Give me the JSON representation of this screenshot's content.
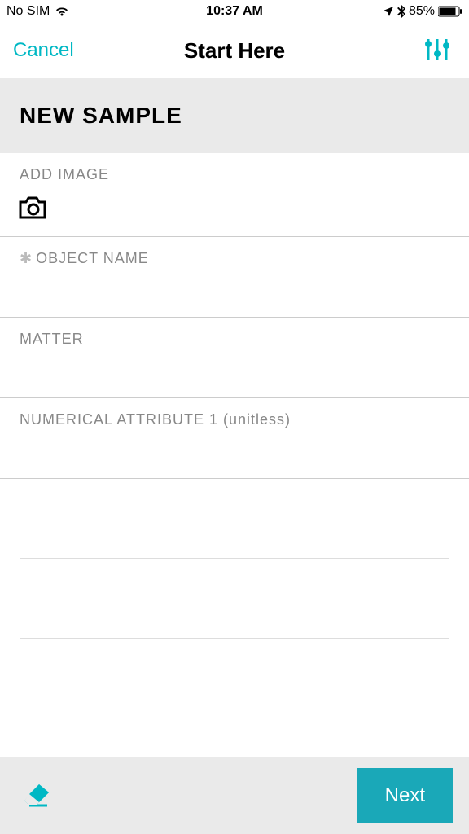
{
  "status": {
    "carrier": "No SIM",
    "time": "10:37 AM",
    "battery": "85%"
  },
  "nav": {
    "cancel": "Cancel",
    "title": "Start Here"
  },
  "section": {
    "title": "NEW SAMPLE"
  },
  "fields": {
    "addImage": "ADD IMAGE",
    "objectName": "OBJECT NAME",
    "matter": "MATTER",
    "numAttr1": "NUMERICAL ATTRIBUTE 1 (unitless)"
  },
  "footer": {
    "next": "Next"
  }
}
